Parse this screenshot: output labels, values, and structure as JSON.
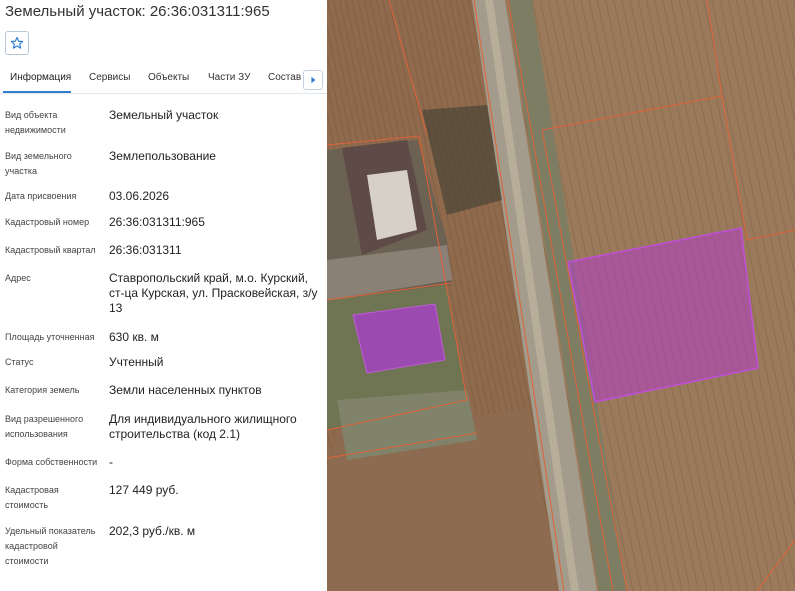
{
  "panel": {
    "title": "Земельный участок: 26:36:031311:965",
    "tabs": [
      "Информация",
      "Сервисы",
      "Объекты",
      "Части ЗУ",
      "Состав"
    ],
    "fields": [
      {
        "label": "Вид объекта недвижимости",
        "value": "Земельный участок"
      },
      {
        "label": "Вид земельного участка",
        "value": "Землепользование"
      },
      {
        "label": "Дата присвоения",
        "value": "03.06.2026"
      },
      {
        "label": "Кадастровый номер",
        "value": "26:36:031311:965"
      },
      {
        "label": "Кадастровый квартал",
        "value": "26:36:031311"
      },
      {
        "label": "Адрес",
        "value": "Ставропольский край, м.о. Курский, ст-ца Курская, ул. Прасковейская, з/у 13"
      },
      {
        "label": "Площадь уточненная",
        "value": "630 кв. м"
      },
      {
        "label": "Статус",
        "value": "Учтенный"
      },
      {
        "label": "Категория земель",
        "value": "Земли населенных пунктов"
      },
      {
        "label": "Вид разрешенного использования",
        "value": "Для индивидуального жилищного строительства (код 2.1)"
      },
      {
        "label": "Форма собственности",
        "value": "-"
      },
      {
        "label": "Кадастровая стоимость",
        "value": "127 449 руб."
      },
      {
        "label": "Удельный показатель кадастровой стоимости",
        "value": "202,3 руб./кв. м"
      }
    ]
  },
  "icons": {
    "favorite": "star-icon",
    "scroll_tabs": "chevron-right-icon"
  },
  "colors": {
    "accent": "#2f7fd1",
    "parcel_highlight": "#b43cc8",
    "cadastral_boundary": "#e0633a"
  }
}
